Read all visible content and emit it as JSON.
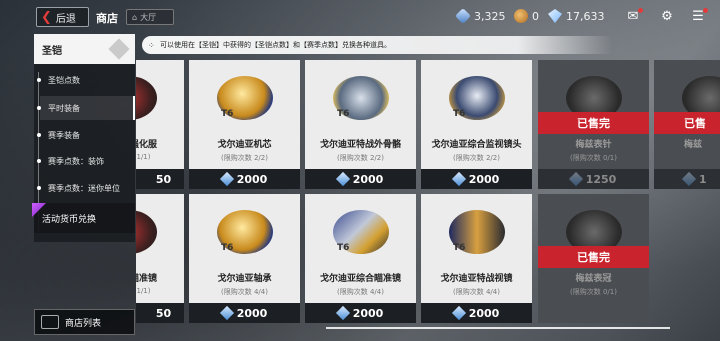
{
  "topbar": {
    "back_label": "后退",
    "title": "商店",
    "hall_label": "大厅",
    "resources": [
      {
        "icon": "cube-currency-icon",
        "value": "3,325"
      },
      {
        "icon": "coin-currency-icon",
        "value": "0"
      },
      {
        "icon": "gem-currency-icon",
        "value": "17,633"
      }
    ]
  },
  "sidebar": {
    "category": "圣铠",
    "items": [
      {
        "label": "圣铠点数",
        "active": false
      },
      {
        "label": "平时装备",
        "active": true
      },
      {
        "label": "赛季装备",
        "active": false
      },
      {
        "label": "赛季点数：装饰",
        "active": false
      },
      {
        "label": "赛季点数：迷你单位",
        "active": false
      }
    ],
    "event_label": "活动货币兑换",
    "shop_list_label": "商店列表"
  },
  "notice": "可以使用在【圣铠】中获得的【圣铠点数】和【赛季点数】兑换各种道具。",
  "cards": [
    {
      "name": "强化服",
      "limit": "1/1)",
      "price": "50",
      "tier": "",
      "sold": false
    },
    {
      "name": "戈尔迪亚机芯",
      "limit": "(限购次数 2/2)",
      "price": "2000",
      "tier": "T6",
      "sold": false
    },
    {
      "name": "戈尔迪亚特战外骨骼",
      "limit": "(限购次数 2/2)",
      "price": "2000",
      "tier": "T6",
      "sold": false
    },
    {
      "name": "戈尔迪亚综合监视镜头",
      "limit": "(限购次数 2/2)",
      "price": "2000",
      "tier": "T6",
      "sold": false
    },
    {
      "name": "梅兹表针",
      "limit": "(限购次数 0/1)",
      "price": "1250",
      "tier": "",
      "sold": true,
      "sold_label": "已售完"
    },
    {
      "name": "梅兹",
      "limit": "",
      "price": "1",
      "tier": "",
      "sold": true,
      "sold_label": "已售"
    },
    {
      "name": "瞄准镜",
      "limit": "1/1)",
      "price": "50",
      "tier": "",
      "sold": false
    },
    {
      "name": "戈尔迪亚轴承",
      "limit": "(限购次数 4/4)",
      "price": "2000",
      "tier": "T6",
      "sold": false
    },
    {
      "name": "戈尔迪亚综合瞄准镜",
      "limit": "(限购次数 4/4)",
      "price": "2000",
      "tier": "T6",
      "sold": false
    },
    {
      "name": "戈尔迪亚特战视镜",
      "limit": "(限购次数 4/4)",
      "price": "2000",
      "tier": "T6",
      "sold": false
    },
    {
      "name": "梅兹表冠",
      "limit": "(限购次数 0/1)",
      "price": "1250",
      "tier": "",
      "sold": true,
      "sold_label": "已售完"
    }
  ]
}
